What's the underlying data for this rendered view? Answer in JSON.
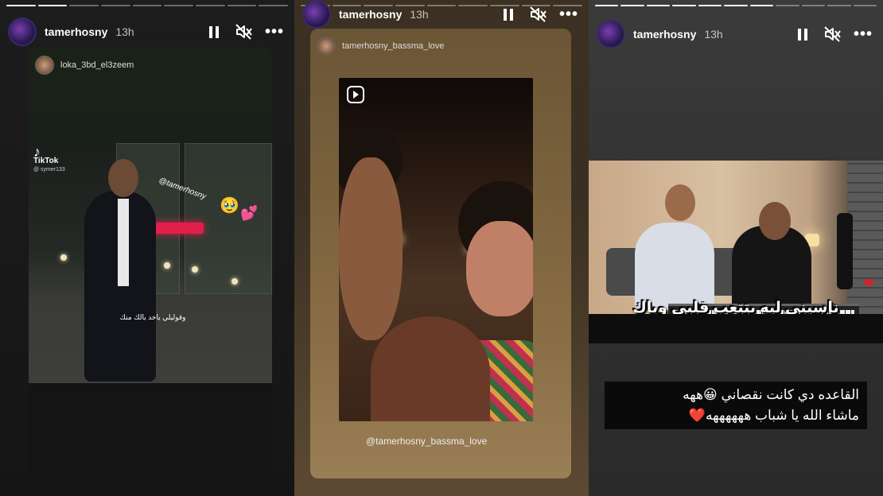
{
  "stories": [
    {
      "username": "tamerhosny",
      "time": "13h",
      "tagged_user": "loka_3bd_el3zeem",
      "tiktok_brand": "TikTok",
      "tiktok_user": "@ symer133",
      "mention_overlay": "@tamerhosny",
      "emoji_1": "🥹",
      "emoji_2": "💕",
      "caption_ar": "وقوليلي ياخد بالك منك",
      "progress_segments": 9,
      "progress_done": 2
    },
    {
      "username": "tamerhosny",
      "time": "13h",
      "tagged_user": "tamerhosny_bassma_love",
      "mention_caption": "@tamerhosny_bassma_love",
      "progress_segments": 9,
      "progress_done": 0
    },
    {
      "username": "tamerhosny",
      "time": "13h",
      "video_overlay_ar": "ناسيني ليه بتتعب قلبي وياك",
      "caption_line_1": "القاعده دي كانت نقصاني 😀ههه",
      "caption_line_2": "ماشاء الله يا شباب ههههههه❤️",
      "heart": "❤",
      "progress_segments": 11,
      "progress_done": 7
    }
  ],
  "icons": {
    "pause": "pause-icon",
    "mute": "mute-icon",
    "more": "more-icon"
  },
  "more_glyph": "•••"
}
